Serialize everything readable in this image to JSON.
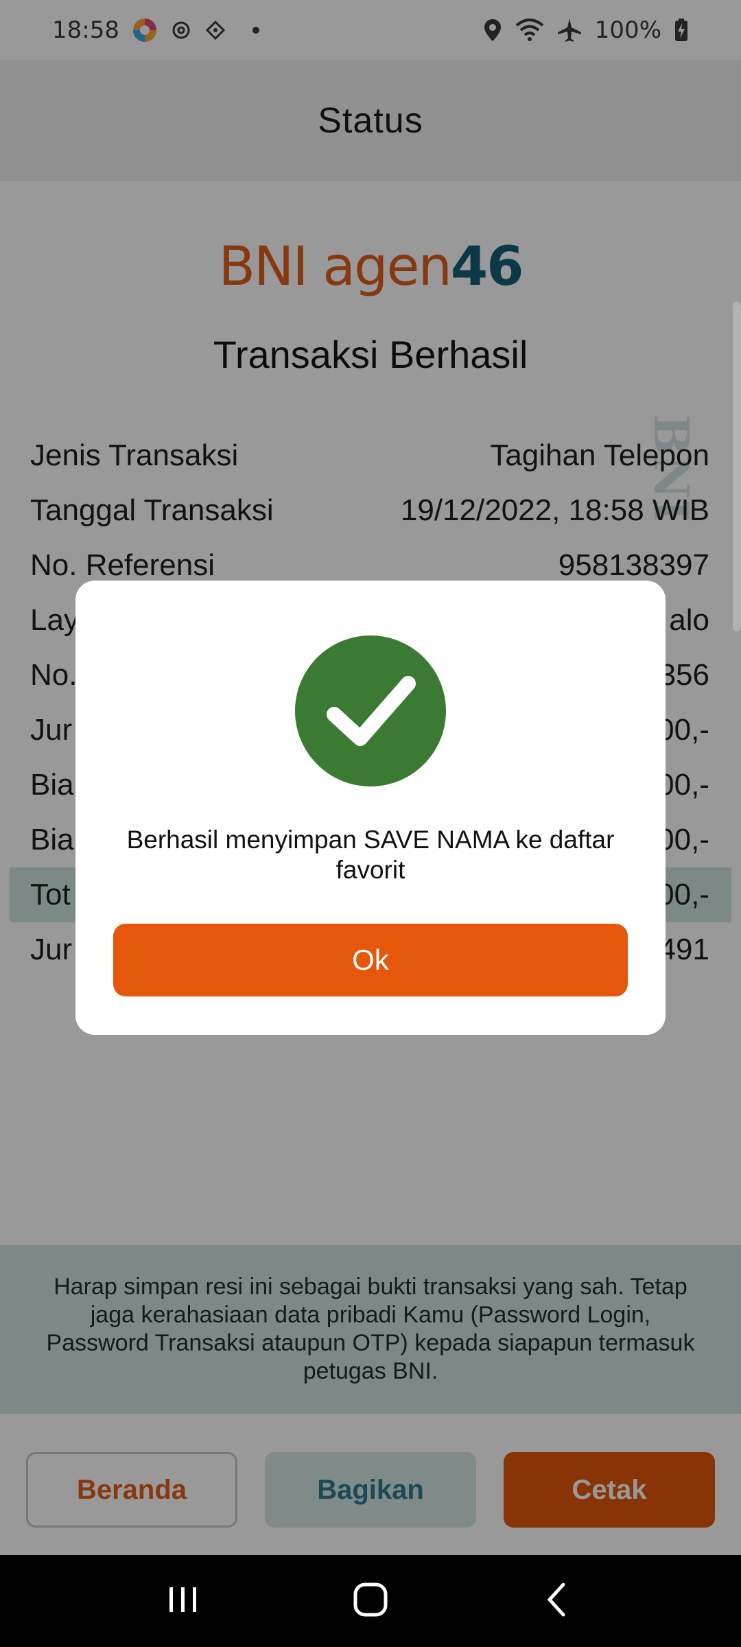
{
  "status_bar": {
    "time": "18:58",
    "battery": "100%",
    "icons": [
      "color-app-icon",
      "settings-icon",
      "android-icon",
      "dot-icon",
      "location-icon",
      "wifi-icon",
      "airplane-icon",
      "battery-icon"
    ]
  },
  "appbar": {
    "title": "Status"
  },
  "logo": {
    "part1": "BNI agen",
    "part2": "46"
  },
  "result_title": "Transaksi Berhasil",
  "details": [
    {
      "label": "Jenis Transaksi",
      "value": "Tagihan Telepon"
    },
    {
      "label": "Tanggal Transaksi",
      "value": "19/12/2022, 18:58 WIB"
    },
    {
      "label": "No. Referensi",
      "value": "958138397"
    },
    {
      "label": "Lay",
      "value": "alo"
    },
    {
      "label": "No.",
      "value": "356"
    },
    {
      "label": "Jur",
      "value": "00,-"
    },
    {
      "label": "Bia",
      "value": "00,-"
    },
    {
      "label": "Bia",
      "value": "00,-"
    },
    {
      "label": "Tot",
      "value": "00,-"
    },
    {
      "label": "Jur",
      "value": "491"
    }
  ],
  "watermark": "BNI",
  "notice": "Harap simpan resi ini sebagai bukti transaksi yang sah. Tetap jaga kerahasiaan data pribadi Kamu (Password Login, Password Transaksi ataupun OTP) kepada siapapun termasuk petugas BNI.",
  "actions": {
    "home": "Beranda",
    "share": "Bagikan",
    "print": "Cetak"
  },
  "dialog": {
    "message": "Berhasil menyimpan SAVE NAMA ke daftar favorit",
    "ok": "Ok",
    "icon": "checkmark-icon"
  },
  "colors": {
    "accent": "#e5570a",
    "brand_teal": "#175e77",
    "success": "#3b7a32"
  }
}
